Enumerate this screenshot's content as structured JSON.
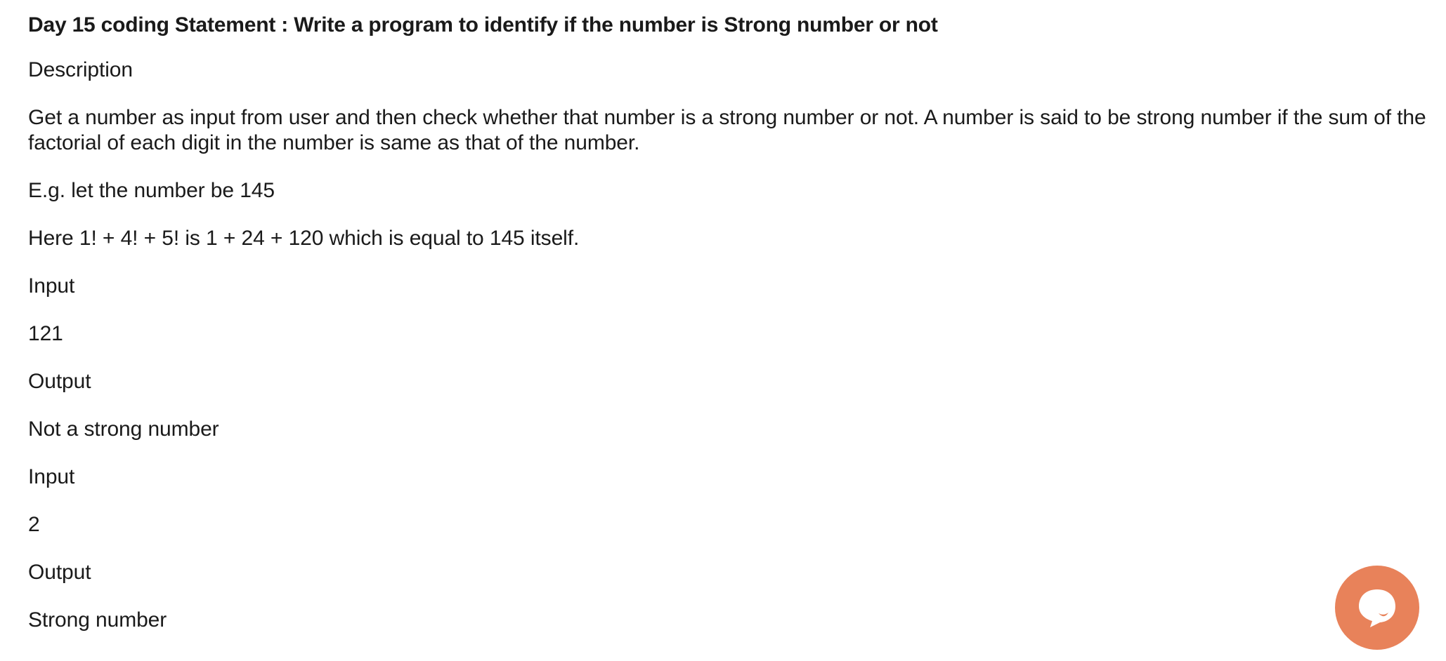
{
  "title": "Day 15 coding Statement : Write a program to identify if the number is Strong number or not",
  "paragraphs": [
    "Description",
    "Get a number as input from user and then check whether that number is a strong number or not. A number is said to be strong number if the sum of the factorial of each digit in the number is same as that of the number.",
    "E.g. let the number be 145",
    "Here 1! + 4! + 5! is 1 + 24 + 120 which is equal to 145 itself.",
    "Input",
    "121",
    "Output",
    "Not a strong number",
    "Input",
    "2",
    "Output",
    "Strong number"
  ],
  "chat_widget": {
    "icon": "chat-bubble-icon",
    "color": "#e8825a"
  }
}
